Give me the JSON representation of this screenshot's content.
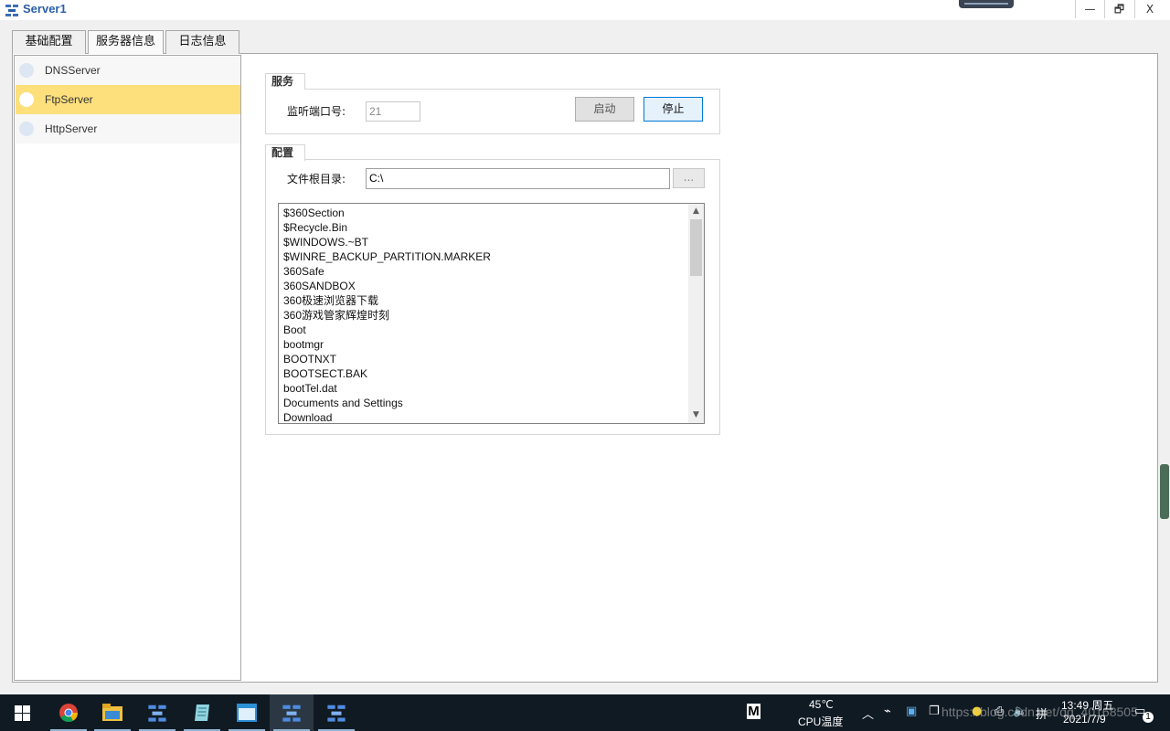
{
  "window": {
    "title": "Server1",
    "minimize": "—",
    "restore": "🗗",
    "close": "X"
  },
  "tabs": [
    {
      "label": "基础配置"
    },
    {
      "label": "服务器信息"
    },
    {
      "label": "日志信息"
    }
  ],
  "services": [
    {
      "label": "DNSServer",
      "selected": false
    },
    {
      "label": "FtpServer",
      "selected": true
    },
    {
      "label": "HttpServer",
      "selected": false
    }
  ],
  "service_group": {
    "title": "服务",
    "port_label": "监听端口号:",
    "port_value": "21",
    "start_button": "启动",
    "stop_button": "停止"
  },
  "config_group": {
    "title": "配置",
    "root_label": "文件根目录:",
    "root_value": "C:\\",
    "browse_button": "...",
    "files": [
      "$360Section",
      "$Recycle.Bin",
      "$WINDOWS.~BT",
      "$WINRE_BACKUP_PARTITION.MARKER",
      "360Safe",
      "360SANDBOX",
      "360极速浏览器下载",
      "360游戏管家辉煌时刻",
      "Boot",
      "bootmgr",
      "BOOTNXT",
      "BOOTSECT.BAK",
      "bootTel.dat",
      "Documents and Settings",
      "Download"
    ]
  },
  "taskbar": {
    "tray_m": "M",
    "cpu_temp": "45℃",
    "cpu_label": "CPU温度",
    "time": "13:49 周五",
    "date": "2021/7/9",
    "notification_count": "1",
    "watermark": "https://blog.csdn.net/qq_40168505",
    "apps": [
      "start-icon",
      "chrome-icon",
      "file-explorer-icon",
      "ensp-icon",
      "notepad-icon",
      "window-icon",
      "ensp-icon",
      "ensp-icon"
    ]
  },
  "colors": {
    "selected_bg": "#fde07c",
    "title_color": "#2a5fa8",
    "taskbar_bg": "#101a23"
  }
}
